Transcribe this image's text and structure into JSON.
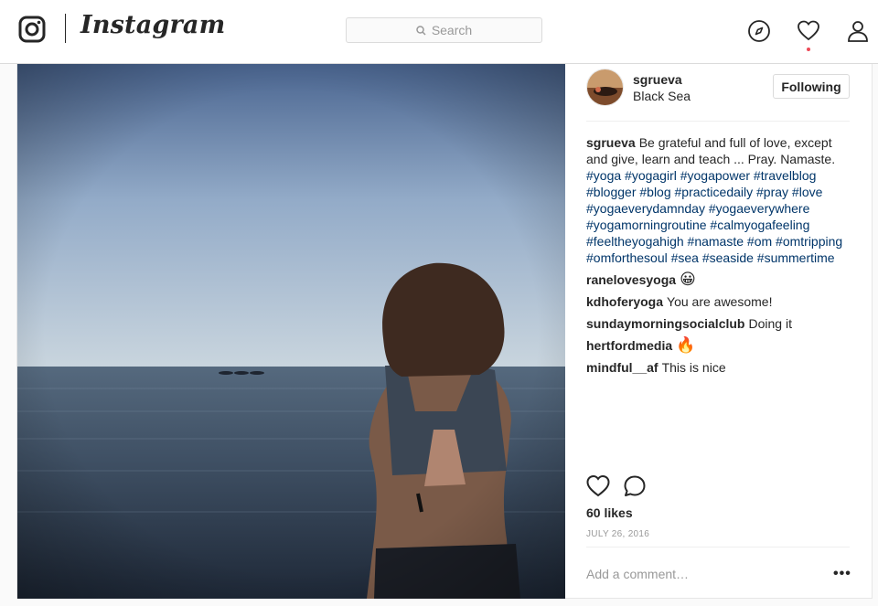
{
  "header": {
    "brand": "Instagram",
    "search_placeholder": "Search"
  },
  "post": {
    "username": "sgrueva",
    "location": "Black Sea",
    "follow_label": "Following",
    "caption_user": "sgrueva",
    "caption_text": "Be grateful and full of love, except and give, learn and teach ... Pray. Namaste.",
    "hashtags": "#yoga #yogagirl #yogapower #travelblog #blogger #blog #practicedaily #pray #love #yogaeverydamnday #yogaeverywhere #yogamorningroutine #calmyogafeeling #feeltheyogahigh #namaste #om #omtripping #omforthesoul #sea #seaside #summertime",
    "comments": [
      {
        "user": "ranelovesyoga",
        "text": "😀"
      },
      {
        "user": "kdhoferyoga",
        "text": "You are awesome!"
      },
      {
        "user": "sundaymorningsocialclub",
        "text": "Doing it"
      },
      {
        "user": "hertfordmedia",
        "text": "🔥"
      },
      {
        "user": "mindful__af",
        "text": "This is nice"
      }
    ],
    "likes": "60 likes",
    "date": "JULY 26, 2016",
    "comment_placeholder": "Add a comment…",
    "more_label": "•••"
  },
  "icons": {
    "logo": "instagram-logo-icon",
    "search": "search-icon",
    "explore": "compass-icon",
    "activity": "heart-icon",
    "profile": "person-icon",
    "like": "heart-outline-icon",
    "comment": "speech-bubble-icon"
  },
  "colors": {
    "hashtag": "#003569",
    "notification_dot": "#ed4956",
    "border": "#dbdbdb"
  }
}
